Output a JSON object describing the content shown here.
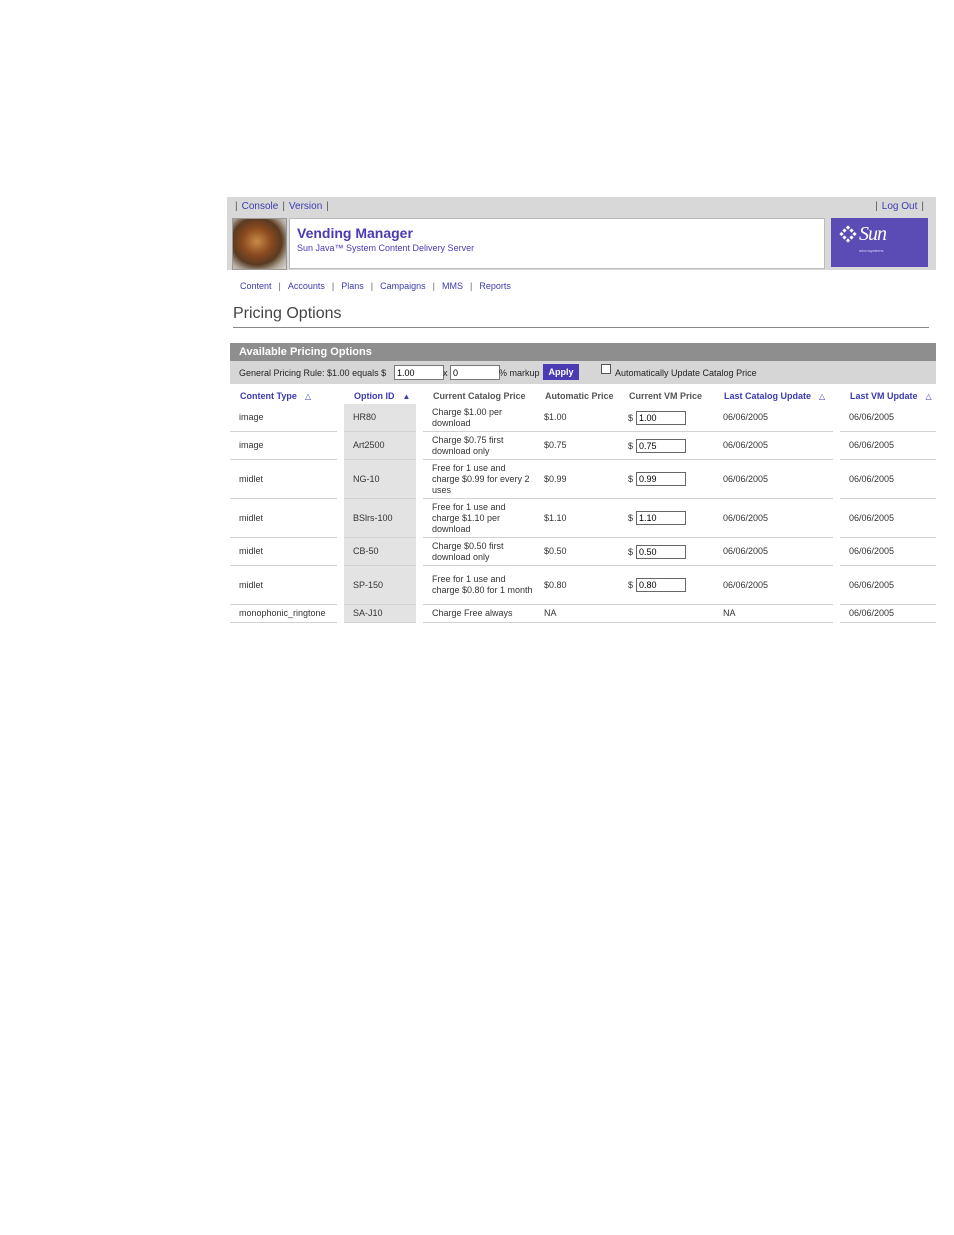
{
  "topbar": {
    "links": [
      "Console",
      "Version"
    ],
    "logout": "Log Out"
  },
  "header": {
    "title": "Vending Manager",
    "subtitle": "Sun Java™ System Content Delivery Server",
    "brand": "Sun",
    "brand_tag": "microsystems"
  },
  "nav": {
    "tabs": [
      "Content",
      "Accounts",
      "Plans",
      "Campaigns",
      "MMS",
      "Reports"
    ]
  },
  "page": {
    "title": "Pricing Options"
  },
  "section": {
    "title": "Available Pricing Options",
    "rule_label": "General Pricing Rule: $1.00 equals $",
    "price_value": "1.00",
    "x_label": "x",
    "markup_value": "0",
    "markup_label": "% markup",
    "apply_label": "Apply",
    "auto_update_label": "Automatically Update Catalog Price",
    "auto_update_checked": false
  },
  "table": {
    "headers": [
      "Content Type",
      "Option ID",
      "Current Catalog Price",
      "Automatic Price",
      "Current VM Price",
      "Last Catalog Update",
      "Last VM Update"
    ],
    "sort_icons": [
      "triangle-up-outline-icon",
      "triangle-up-filled-icon",
      "",
      "",
      "",
      "triangle-up-outline-icon",
      "triangle-up-outline-icon"
    ],
    "currency_symbol": "$",
    "rows": [
      {
        "type": "image",
        "option_id": "HR80",
        "catalog_price": "Charge $1.00 per download",
        "auto_price": "$1.00",
        "vm_price": "1.00",
        "last_catalog": "06/06/2005",
        "last_vm": "06/06/2005"
      },
      {
        "type": "image",
        "option_id": "Art2500",
        "catalog_price": "Charge $0.75 first download only",
        "auto_price": "$0.75",
        "vm_price": "0.75",
        "last_catalog": "06/06/2005",
        "last_vm": "06/06/2005"
      },
      {
        "type": "midlet",
        "option_id": "NG-10",
        "catalog_price": "Free for 1 use and charge $0.99 for every 2 uses",
        "auto_price": "$0.99",
        "vm_price": "0.99",
        "last_catalog": "06/06/2005",
        "last_vm": "06/06/2005"
      },
      {
        "type": "midlet",
        "option_id": "BSlrs-100",
        "catalog_price": "Free for 1 use and charge $1.10 per download",
        "auto_price": "$1.10",
        "vm_price": "1.10",
        "last_catalog": "06/06/2005",
        "last_vm": "06/06/2005"
      },
      {
        "type": "midlet",
        "option_id": "CB-50",
        "catalog_price": "Charge $0.50 first download only",
        "auto_price": "$0.50",
        "vm_price": "0.50",
        "last_catalog": "06/06/2005",
        "last_vm": "06/06/2005"
      },
      {
        "type": "midlet",
        "option_id": "SP-150",
        "catalog_price": "Free for 1 use and charge $0.80 for 1 month",
        "auto_price": "$0.80",
        "vm_price": "0.80",
        "last_catalog": "06/06/2005",
        "last_vm": "06/06/2005"
      },
      {
        "type": "monophonic_ringtone",
        "option_id": "SA-J10",
        "catalog_price": "Charge Free always",
        "auto_price": "NA",
        "vm_price": "",
        "last_catalog": "NA",
        "last_vm": "06/06/2005"
      }
    ]
  },
  "colors": {
    "accent": "#4a3bb5",
    "link": "#3b3bb0",
    "section_bar": "#8e8e8e",
    "header_bg": "#d8d8d8"
  }
}
